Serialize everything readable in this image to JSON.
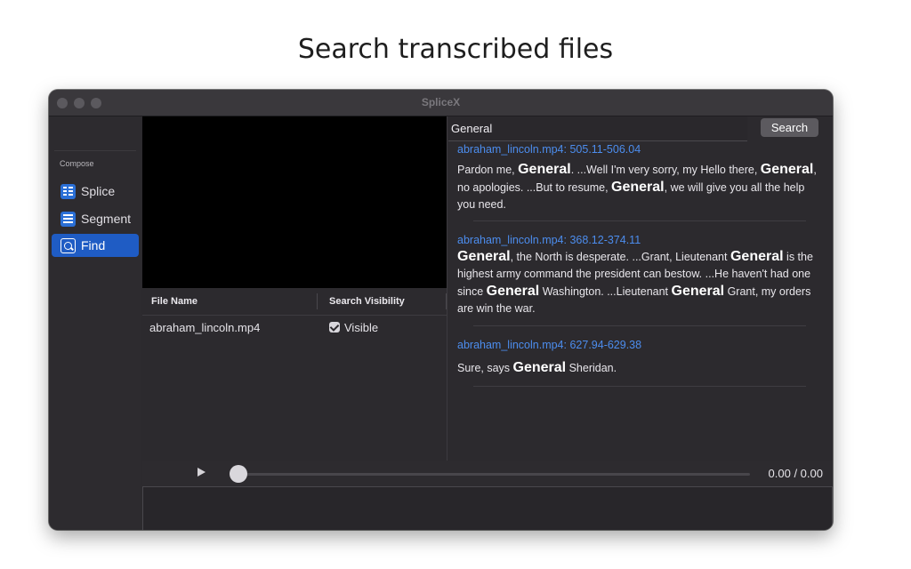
{
  "page": {
    "heading": "Search transcribed files"
  },
  "window": {
    "title": "SpliceX"
  },
  "sidebar": {
    "section": "Compose",
    "items": [
      {
        "label": "Splice",
        "icon": "splice-icon",
        "active": false
      },
      {
        "label": "Segment",
        "icon": "segment-icon",
        "active": false
      },
      {
        "label": "Find",
        "icon": "find-icon",
        "active": true
      }
    ]
  },
  "files": {
    "columns": [
      "File Name",
      "Search Visibility"
    ],
    "rows": [
      {
        "name": "abraham_lincoln.mp4",
        "visibility": "Visible",
        "checked": true
      }
    ]
  },
  "search": {
    "query": "General",
    "button_label": "Search",
    "results": [
      {
        "title": "abraham_lincoln.mp4: 505.11-506.04",
        "segments": [
          {
            "t": "Pardon me, "
          },
          {
            "t": "General",
            "b": true
          },
          {
            "t": ". ...Well I'm very sorry, my Hello there, "
          },
          {
            "t": "General",
            "b": true
          },
          {
            "t": ", no apologies. ...But to resume, "
          },
          {
            "t": "General",
            "b": true
          },
          {
            "t": ", we will give you all the help you need."
          }
        ]
      },
      {
        "title": "abraham_lincoln.mp4: 368.12-374.11",
        "segments": [
          {
            "t": "General",
            "b": true
          },
          {
            "t": ", the North is desperate. ...Grant, Lieutenant "
          },
          {
            "t": "General",
            "b": true
          },
          {
            "t": " is the highest army command the president can bestow. ...He haven't had one since "
          },
          {
            "t": "General",
            "b": true
          },
          {
            "t": " Washington. ...Lieutenant "
          },
          {
            "t": "General",
            "b": true
          },
          {
            "t": " Grant, my orders are win the war."
          }
        ]
      },
      {
        "title": "abraham_lincoln.mp4: 627.94-629.38",
        "segments": [
          {
            "t": "Sure, says "
          },
          {
            "t": "General",
            "b": true
          },
          {
            "t": " Sheridan."
          }
        ]
      }
    ]
  },
  "player": {
    "time": "0.00 / 0.00",
    "progress": 0
  }
}
